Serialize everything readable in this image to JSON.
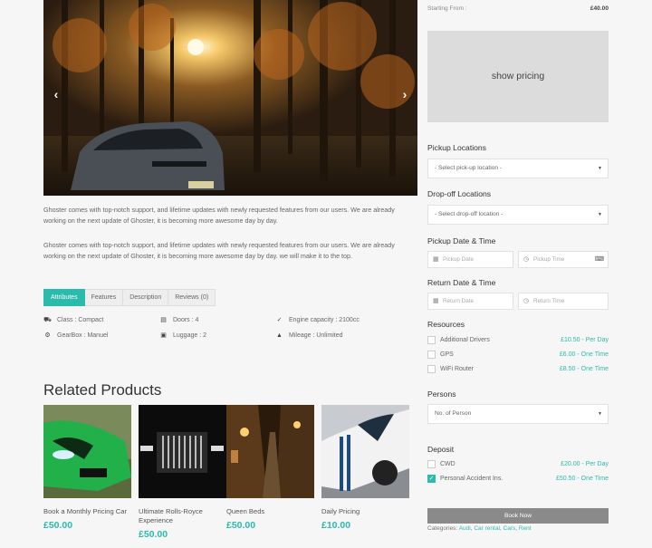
{
  "gallery": {
    "prev_icon": "chevron-left-icon",
    "next_icon": "chevron-right-icon",
    "prev_glyph": "‹",
    "next_glyph": "›"
  },
  "description": {
    "p1": "Ghoster comes with top-notch support, and lifetime updates with newly requested features from our users. We are already working on the next update of Ghoster, it is becoming more awesome day by day.",
    "p2": "Ghoster comes with top-notch support, and lifetime updates with newly requested features from our users. We are already working on the next update of Ghoster, it is becoming more awesome day by day. we will make it to the top."
  },
  "tabs": [
    {
      "label": "Attributes",
      "active": true
    },
    {
      "label": "Features"
    },
    {
      "label": "Description"
    },
    {
      "label": "Reviews (0)"
    }
  ],
  "attributes": {
    "class": "Class : Compact",
    "doors": "Doors : 4",
    "engine": "Engine capacity : 2100cc",
    "gearbox": "GearBox : Manuel",
    "luggage": "Luggage : 2",
    "mileage": "Mileage : Unlimited"
  },
  "related": {
    "title": "Related Products",
    "items": [
      {
        "name": "Book a Monthly Pricing Car",
        "price": "£50.00"
      },
      {
        "name": "Ultimate Rolls-Royce Experience",
        "price": "£50.00"
      },
      {
        "name": "Queen Beds",
        "price": "£50.00"
      },
      {
        "name": "Daily Pricing",
        "price": "£10.00"
      }
    ]
  },
  "sidebar": {
    "starting_label": "Starting From :",
    "starting_value": "£40.00",
    "pricing_button": "show pricing",
    "pickup_locations": {
      "label": "Pickup Locations",
      "placeholder": "- Select pick-up location -"
    },
    "dropoff_locations": {
      "label": "Drop-off Locations",
      "placeholder": "- Select drop-off location -"
    },
    "pickup_datetime": {
      "label": "Pickup Date & Time",
      "date_placeholder": "Pickup Date",
      "time_placeholder": "Pickup Time"
    },
    "return_datetime": {
      "label": "Return Date & Time",
      "date_placeholder": "Return Date",
      "time_placeholder": "Return Time"
    },
    "resources": {
      "label": "Resources",
      "items": [
        {
          "name": "Additional Drivers",
          "price": "£10.50 - Per Day",
          "checked": false
        },
        {
          "name": "GPS",
          "price": "£6.00 - One Time",
          "checked": false
        },
        {
          "name": "WiFi Router",
          "price": "£8.50 - One Time",
          "checked": false
        }
      ]
    },
    "persons": {
      "label": "Persons",
      "placeholder": "No. of Person"
    },
    "deposit": {
      "label": "Deposit",
      "items": [
        {
          "name": "CWD",
          "price": "£20.00 - Per Day",
          "checked": false
        },
        {
          "name": "Personal Accident Ins.",
          "price": "£50.50 - One Time",
          "checked": true
        }
      ]
    },
    "book_button": "Book Now",
    "categories_label": "Categories:",
    "categories": [
      "Audi",
      "Car rental",
      "Cars",
      "Rent"
    ]
  },
  "colors": {
    "accent": "#2bbbad",
    "button": "#8a8a8a",
    "pricing_box": "#dcdcdc"
  }
}
